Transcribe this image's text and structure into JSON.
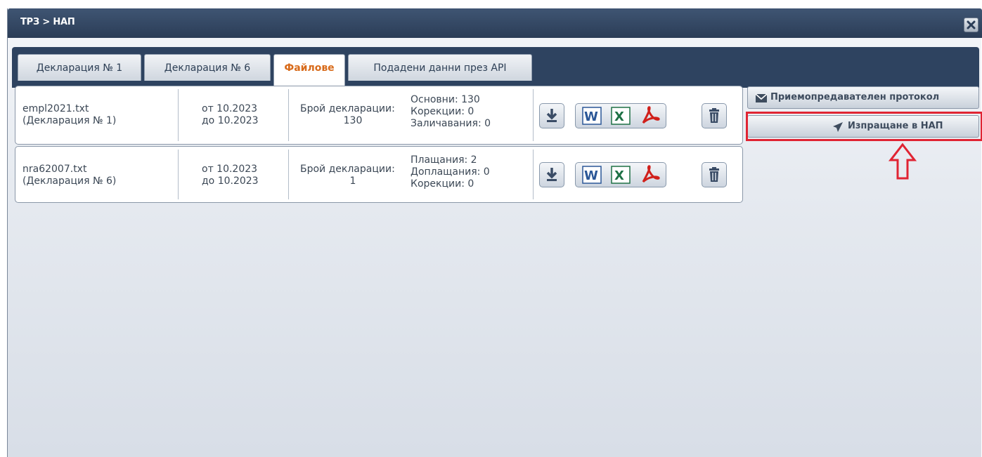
{
  "window": {
    "title": "ТРЗ > НАП",
    "close_icon": "close-icon"
  },
  "tabs": [
    {
      "label": "Декларация № 1",
      "active": false
    },
    {
      "label": "Декларация № 6",
      "active": false
    },
    {
      "label": "Файлове",
      "active": true
    },
    {
      "label": "Подадени данни през API",
      "active": false
    }
  ],
  "files": [
    {
      "file_name": "empl2021.txt",
      "declaration": "(Декларация № 1)",
      "period_from": "от 10.2023",
      "period_to": "до 10.2023",
      "count_label": "Брой декларации:",
      "count_value": "130",
      "details": [
        "Основни: 130",
        "Корекции: 0",
        "Заличавания: 0"
      ]
    },
    {
      "file_name": "nra62007.txt",
      "declaration": "(Декларация № 6)",
      "period_from": "от 10.2023",
      "period_to": "до 10.2023",
      "count_label": "Брой декларации:",
      "count_value": "1",
      "details": [
        "Плащания: 2",
        "Доплащания: 0",
        "Корекции: 0"
      ]
    }
  ],
  "actions": {
    "protocol_label": "Приемопредавателен протокол",
    "protocol_icon": "envelope-icon",
    "send_label": "Изпращане в НАП",
    "send_icon": "paper-plane-icon"
  },
  "colors": {
    "titlebar": "#2b3d57",
    "active_tab_text": "#d86b1b",
    "highlight": "#e02433",
    "word": "#2b5797",
    "excel": "#1e7145",
    "pdf": "#d0201b"
  }
}
